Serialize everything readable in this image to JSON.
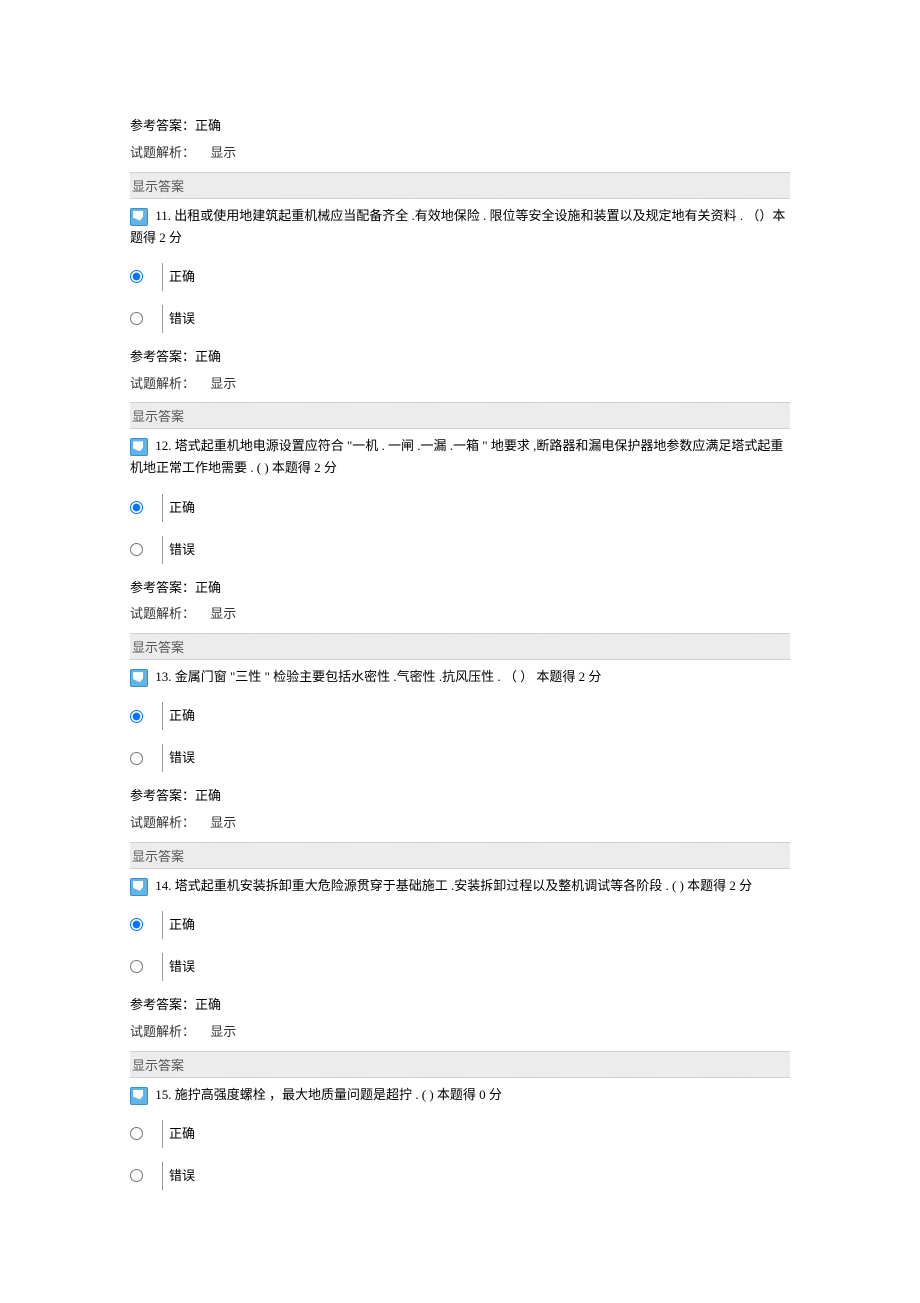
{
  "labels": {
    "ref_answer_prefix": "参考答案：",
    "analysis_prefix": "试题解析：",
    "analysis_link": "显示",
    "show_answer": "显示答案",
    "opt_true": "正确",
    "opt_false": "错误"
  },
  "pre": {
    "ref_answer": "正确"
  },
  "questions": [
    {
      "num": "11.",
      "text_a": " 出租或使用地建筑起重机械应当配备齐全",
      "text_b": "     .有效地保险 . 限位等安全设施和装置以及规定地有关资料",
      "text_c": "     . （）本题得 2 分",
      "selected": "true",
      "ref_answer": "正确"
    },
    {
      "num": "12.",
      "text_a": " 塔式起重机地电源设置应符合 \"一机 . 一闸 .一漏 .一箱 \" 地要求 ,断路器和漏电保护器地参数应满足塔式起重机地正常工作地需要 . (  )   本题得 2 分",
      "text_b": "",
      "text_c": "",
      "selected": "true",
      "ref_answer": "正确"
    },
    {
      "num": "13.",
      "text_a": " 金属门窗 \"三性 \" 检验主要包括水密性  .气密性 .抗风压性 . （ ）  本题得  2 分",
      "text_b": "",
      "text_c": "",
      "selected": "true",
      "ref_answer": "正确"
    },
    {
      "num": "14.",
      "text_a": " 塔式起重机安装拆卸重大危险源贯穿于基础施工      .安装拆卸过程以及整机调试等各阶段    . (  )   本题得 2 分",
      "text_b": "",
      "text_c": "",
      "selected": "true",
      "ref_answer": "正确"
    },
    {
      "num": "15.",
      "text_a": " 施拧高强度螺栓  ，最大地质量问题是超拧  . (  )   本题得  0 分",
      "text_b": "",
      "text_c": "",
      "selected": "none",
      "ref_answer": "",
      "no_footer": true
    }
  ]
}
